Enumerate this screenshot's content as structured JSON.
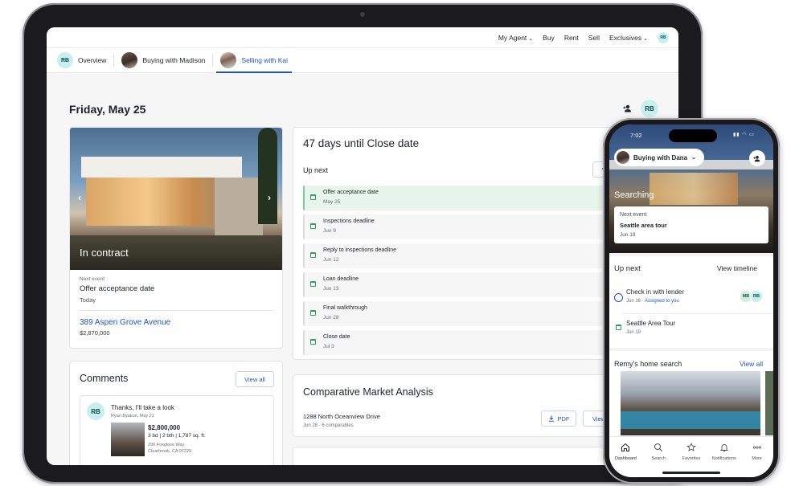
{
  "tablet": {
    "topnav": {
      "items": [
        "My Agent",
        "Buy",
        "Rent",
        "Sell",
        "Exclusives"
      ],
      "avatar": "RB"
    },
    "tabs": [
      {
        "label": "Overview",
        "avatar": "RB"
      },
      {
        "label": "Buying with Madison"
      },
      {
        "label": "Selling with Kai"
      }
    ],
    "date_title": "Friday, May 25",
    "header_avatar": "RB",
    "property": {
      "status": "In contract",
      "next_label": "Next event",
      "next_title": "Offer acceptance date",
      "next_when": "Today",
      "address": "389 Aspen Grove Avenue",
      "price": "$2,870,000"
    },
    "comments": {
      "title": "Comments",
      "view_all": "View all",
      "avatar": "RB",
      "text": "Thanks, I'll take a look",
      "meta": "Ryan Byakun, May 21",
      "listing_price": "$2,800,000",
      "listing_specs": "3 bd | 2 bth | 1,787 sq. ft.",
      "listing_addr1": "290 Foxglove Way",
      "listing_addr2": "Clearbrook, CA 97229"
    },
    "close": {
      "title": "47 days until Close date",
      "up_next": "Up next",
      "view_btn": "Vi",
      "events": [
        {
          "title": "Offer acceptance date",
          "date": "May 25",
          "done": true
        },
        {
          "title": "Inspections deadline",
          "date": "Jun 9",
          "done": false
        },
        {
          "title": "Reply to inspections deadline",
          "date": "Jun 12",
          "done": false
        },
        {
          "title": "Loan deadline",
          "date": "Jun 13",
          "done": false
        },
        {
          "title": "Final walkthrough",
          "date": "Jun 28",
          "done": false
        },
        {
          "title": "Close date",
          "date": "Jul 3",
          "done": false
        }
      ]
    },
    "cma": {
      "title": "Comparative Market Analysis",
      "address": "1288 North Oceanview Drive",
      "sub": "Jun 28 · 6 comparables",
      "pdf_label": "PDF",
      "view_label": "View"
    }
  },
  "phone": {
    "time": "7:02",
    "buying_pill": "Buying with Dana",
    "status": "Searching",
    "next_card": {
      "label": "Next event",
      "title": "Seattle area tour",
      "date": "Jun 19"
    },
    "up_next": "Up next",
    "view_timeline": "View timeline",
    "tasks": [
      {
        "title": "Check in with lender",
        "date": "Jun 16",
        "assigned": "Assigned to you",
        "avatars": [
          "MB",
          "RB"
        ]
      },
      {
        "title": "Seattle Area Tour",
        "date": "Jun 19"
      }
    ],
    "home_search_title": "Remy's home search",
    "view_all": "View all",
    "tabbar": [
      "Dashboard",
      "Search",
      "Favorites",
      "Notifications",
      "More"
    ]
  },
  "colors": {
    "accent": "#1b55c9",
    "event_done_bg": "#e8f5ec",
    "event_done_border": "#7cc996",
    "avatar_bg": "#c7efee"
  }
}
